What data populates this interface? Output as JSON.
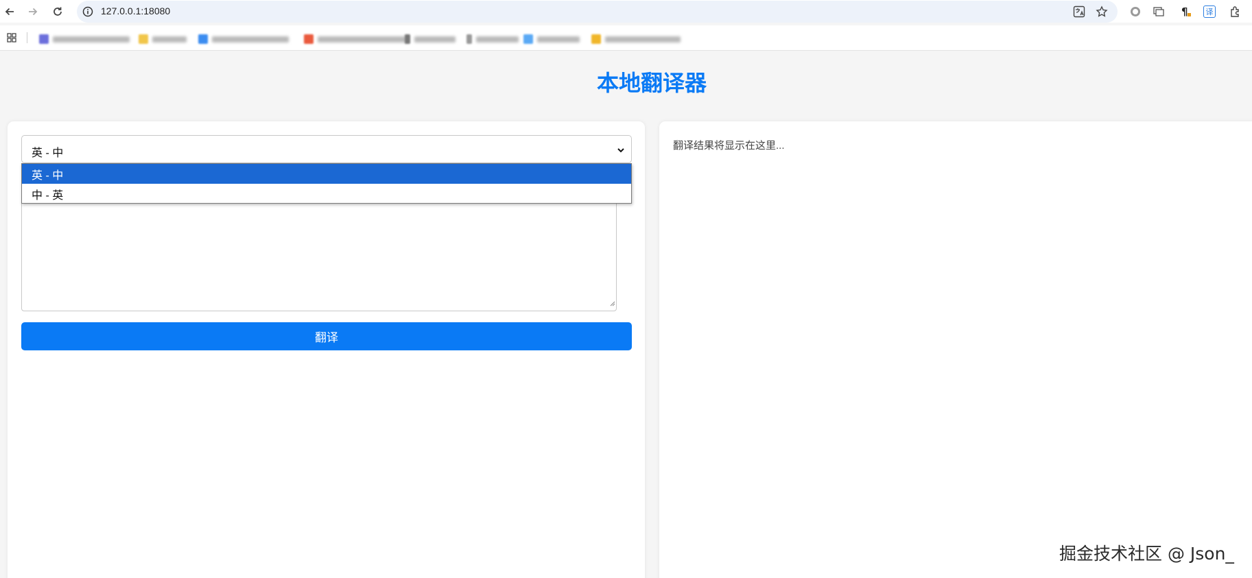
{
  "browser": {
    "url": "127.0.0.1:18080",
    "icons": [
      "back-icon",
      "forward-icon",
      "reload-icon",
      "site-info-icon",
      "translate-page-icon",
      "bookmark-star-icon",
      "extension-record-icon",
      "extension-tabs-icon",
      "extension-paragraph-icon",
      "extension-translate-icon",
      "extensions-puzzle-icon",
      "apps-grid-icon"
    ],
    "extension_translate_glyph": "译"
  },
  "page": {
    "title": "本地翻译器"
  },
  "translator": {
    "direction_selected": "英 - 中",
    "options": [
      "英 - 中",
      "中 - 英"
    ],
    "translate_button": "翻译",
    "result_placeholder": "翻译结果将显示在这里..."
  },
  "watermark": {
    "text": "掘金技术社区 @ Json_"
  },
  "colors": {
    "accent": "#0a7af5",
    "selected_option": "#1b68d3",
    "page_bg": "#f5f5f5"
  }
}
